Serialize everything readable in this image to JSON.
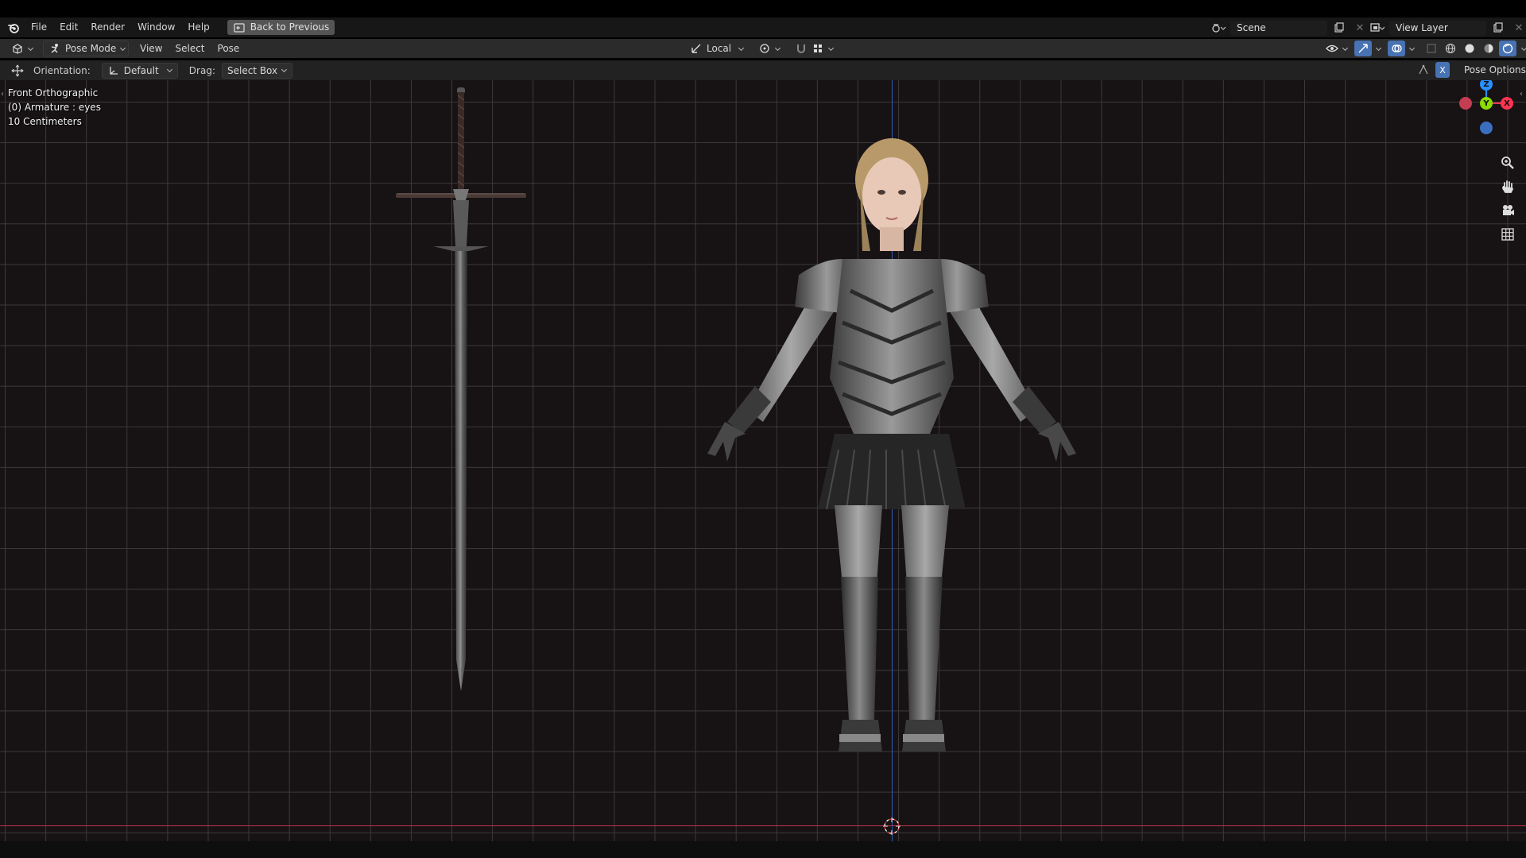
{
  "topbar": {
    "menu": [
      "File",
      "Edit",
      "Render",
      "Window",
      "Help"
    ],
    "back_button": "Back to Previous",
    "scene_name": "Scene",
    "view_layer_name": "View Layer"
  },
  "header": {
    "mode": "Pose Mode",
    "menus": [
      "View",
      "Select",
      "Pose"
    ],
    "pivot": "Local"
  },
  "tool_settings": {
    "orientation_label": "Orientation:",
    "orientation_value": "Default",
    "drag_label": "Drag:",
    "drag_value": "Select Box",
    "x_mirror": "X",
    "pose_options": "Pose Options"
  },
  "viewport": {
    "view_name": "Front Orthographic",
    "object_info": "(0) Armature : eyes",
    "grid_scale": "10 Centimeters"
  },
  "gizmo": {
    "z_label": "Z",
    "y_label": "Y",
    "x_label": "X",
    "colors": {
      "x": "#ff3352",
      "y": "#8bdc00",
      "z": "#2890ff"
    }
  },
  "icons": [
    "blender-logo-icon",
    "zoom-icon",
    "hand-pan-icon",
    "camera-icon",
    "grid-icon"
  ],
  "colors": {
    "accent": "#4772b3",
    "x_axis_line": "#c8334a",
    "z_axis_line": "#2c5fb3"
  }
}
